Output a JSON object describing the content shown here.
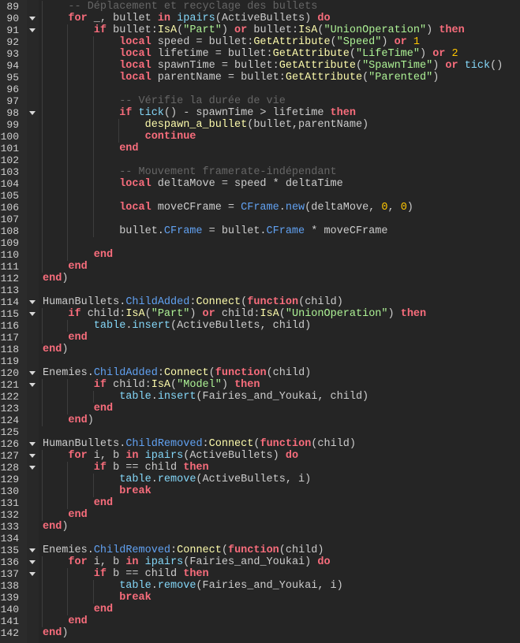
{
  "editor": {
    "colors": {
      "keyword": "#f86d7c",
      "string": "#adf195",
      "number": "#ffc600",
      "method": "#fdfbac",
      "builtin": "#84d6f7",
      "property": "#61a1f1",
      "comment": "#666666",
      "text": "#cccccc",
      "background": "#252525"
    },
    "lines": [
      {
        "num": "89",
        "indent": 4,
        "fold": false,
        "tokens": [
          [
            "cm",
            "-- Déplacement et recyclage des bullets"
          ]
        ]
      },
      {
        "num": "90",
        "indent": 4,
        "fold": true,
        "tokens": [
          [
            "kw",
            "for"
          ],
          [
            "tx",
            " _, bullet "
          ],
          [
            "kw",
            "in"
          ],
          [
            "tx",
            " "
          ],
          [
            "bi",
            "ipairs"
          ],
          [
            "tx",
            "(ActiveBullets) "
          ],
          [
            "kw",
            "do"
          ]
        ]
      },
      {
        "num": "91",
        "indent": 8,
        "fold": true,
        "tokens": [
          [
            "kw",
            "if"
          ],
          [
            "tx",
            " bullet:"
          ],
          [
            "fn",
            "IsA"
          ],
          [
            "tx",
            "("
          ],
          [
            "str",
            "\"Part\""
          ],
          [
            "tx",
            ") "
          ],
          [
            "kw",
            "or"
          ],
          [
            "tx",
            " bullet:"
          ],
          [
            "fn",
            "IsA"
          ],
          [
            "tx",
            "("
          ],
          [
            "str",
            "\"UnionOperation\""
          ],
          [
            "tx",
            ") "
          ],
          [
            "kw",
            "then"
          ]
        ]
      },
      {
        "num": "92",
        "indent": 12,
        "fold": false,
        "tokens": [
          [
            "kw",
            "local"
          ],
          [
            "tx",
            " speed = bullet:"
          ],
          [
            "fn",
            "GetAttribute"
          ],
          [
            "tx",
            "("
          ],
          [
            "str",
            "\"Speed\""
          ],
          [
            "tx",
            ") "
          ],
          [
            "kw",
            "or"
          ],
          [
            "tx",
            " "
          ],
          [
            "num",
            "1"
          ]
        ]
      },
      {
        "num": "93",
        "indent": 12,
        "fold": false,
        "tokens": [
          [
            "kw",
            "local"
          ],
          [
            "tx",
            " lifetime = bullet:"
          ],
          [
            "fn",
            "GetAttribute"
          ],
          [
            "tx",
            "("
          ],
          [
            "str",
            "\"LifeTime\""
          ],
          [
            "tx",
            ") "
          ],
          [
            "kw",
            "or"
          ],
          [
            "tx",
            " "
          ],
          [
            "num",
            "2"
          ]
        ]
      },
      {
        "num": "94",
        "indent": 12,
        "fold": false,
        "tokens": [
          [
            "kw",
            "local"
          ],
          [
            "tx",
            " spawnTime = bullet:"
          ],
          [
            "fn",
            "GetAttribute"
          ],
          [
            "tx",
            "("
          ],
          [
            "str",
            "\"SpawnTime\""
          ],
          [
            "tx",
            ") "
          ],
          [
            "kw",
            "or"
          ],
          [
            "tx",
            " "
          ],
          [
            "bi",
            "tick"
          ],
          [
            "tx",
            "()"
          ]
        ]
      },
      {
        "num": "95",
        "indent": 12,
        "fold": false,
        "tokens": [
          [
            "kw",
            "local"
          ],
          [
            "tx",
            " parentName = bullet:"
          ],
          [
            "fn",
            "GetAttribute"
          ],
          [
            "tx",
            "("
          ],
          [
            "str",
            "\"Parented\""
          ],
          [
            "tx",
            ")"
          ]
        ]
      },
      {
        "num": "96",
        "indent": -1,
        "fold": false,
        "tokens": []
      },
      {
        "num": "97",
        "indent": 12,
        "fold": false,
        "tokens": [
          [
            "cm",
            "-- Vérifie la durée de vie"
          ]
        ]
      },
      {
        "num": "98",
        "indent": 12,
        "fold": true,
        "tokens": [
          [
            "kw",
            "if"
          ],
          [
            "tx",
            " "
          ],
          [
            "bi",
            "tick"
          ],
          [
            "tx",
            "() - spawnTime > lifetime "
          ],
          [
            "kw",
            "then"
          ]
        ]
      },
      {
        "num": "99",
        "indent": 16,
        "fold": false,
        "tokens": [
          [
            "fn",
            "despawn_a_bullet"
          ],
          [
            "tx",
            "(bullet,parentName)"
          ]
        ]
      },
      {
        "num": "100",
        "indent": 16,
        "fold": false,
        "tokens": [
          [
            "kw",
            "continue"
          ]
        ]
      },
      {
        "num": "101",
        "indent": 12,
        "fold": false,
        "tokens": [
          [
            "kw",
            "end"
          ]
        ]
      },
      {
        "num": "102",
        "indent": -1,
        "fold": false,
        "tokens": []
      },
      {
        "num": "103",
        "indent": 12,
        "fold": false,
        "tokens": [
          [
            "cm",
            "-- Mouvement framerate-indépendant"
          ]
        ]
      },
      {
        "num": "104",
        "indent": 12,
        "fold": false,
        "tokens": [
          [
            "kw",
            "local"
          ],
          [
            "tx",
            " deltaMove = speed * deltaTime"
          ]
        ]
      },
      {
        "num": "105",
        "indent": -1,
        "fold": false,
        "tokens": []
      },
      {
        "num": "106",
        "indent": 12,
        "fold": false,
        "tokens": [
          [
            "kw",
            "local"
          ],
          [
            "tx",
            " moveCFrame = "
          ],
          [
            "prop",
            "CFrame"
          ],
          [
            "tx",
            "."
          ],
          [
            "prop",
            "new"
          ],
          [
            "tx",
            "(deltaMove, "
          ],
          [
            "num",
            "0"
          ],
          [
            "tx",
            ", "
          ],
          [
            "num",
            "0"
          ],
          [
            "tx",
            ")"
          ]
        ]
      },
      {
        "num": "107",
        "indent": -1,
        "fold": false,
        "tokens": []
      },
      {
        "num": "108",
        "indent": 12,
        "fold": false,
        "tokens": [
          [
            "tx",
            "bullet."
          ],
          [
            "prop",
            "CFrame"
          ],
          [
            "tx",
            " = bullet."
          ],
          [
            "prop",
            "CFrame"
          ],
          [
            "tx",
            " * moveCFrame"
          ]
        ]
      },
      {
        "num": "109",
        "indent": -1,
        "fold": false,
        "tokens": []
      },
      {
        "num": "110",
        "indent": 8,
        "fold": false,
        "tokens": [
          [
            "kw",
            "end"
          ]
        ]
      },
      {
        "num": "111",
        "indent": 4,
        "fold": false,
        "tokens": [
          [
            "kw",
            "end"
          ]
        ]
      },
      {
        "num": "112",
        "indent": 0,
        "fold": false,
        "tokens": [
          [
            "kw",
            "end"
          ],
          [
            "tx",
            ")"
          ]
        ]
      },
      {
        "num": "113",
        "indent": -1,
        "fold": false,
        "tokens": []
      },
      {
        "num": "114",
        "indent": 0,
        "fold": true,
        "tokens": [
          [
            "tx",
            "HumanBullets."
          ],
          [
            "prop",
            "ChildAdded"
          ],
          [
            "tx",
            ":"
          ],
          [
            "fn",
            "Connect"
          ],
          [
            "tx",
            "("
          ],
          [
            "kw",
            "function"
          ],
          [
            "tx",
            "(child)"
          ]
        ]
      },
      {
        "num": "115",
        "indent": 4,
        "fold": true,
        "tokens": [
          [
            "kw",
            "if"
          ],
          [
            "tx",
            " child:"
          ],
          [
            "fn",
            "IsA"
          ],
          [
            "tx",
            "("
          ],
          [
            "str",
            "\"Part\""
          ],
          [
            "tx",
            ") "
          ],
          [
            "kw",
            "or"
          ],
          [
            "tx",
            " child:"
          ],
          [
            "fn",
            "IsA"
          ],
          [
            "tx",
            "("
          ],
          [
            "str",
            "\"UnionOperation\""
          ],
          [
            "tx",
            ") "
          ],
          [
            "kw",
            "then"
          ]
        ]
      },
      {
        "num": "116",
        "indent": 8,
        "fold": false,
        "tokens": [
          [
            "bi",
            "table"
          ],
          [
            "tx",
            "."
          ],
          [
            "bi",
            "insert"
          ],
          [
            "tx",
            "(ActiveBullets, child)"
          ]
        ]
      },
      {
        "num": "117",
        "indent": 4,
        "fold": false,
        "tokens": [
          [
            "kw",
            "end"
          ]
        ]
      },
      {
        "num": "118",
        "indent": 0,
        "fold": false,
        "tokens": [
          [
            "kw",
            "end"
          ],
          [
            "tx",
            ")"
          ]
        ]
      },
      {
        "num": "119",
        "indent": -1,
        "fold": false,
        "tokens": []
      },
      {
        "num": "120",
        "indent": 0,
        "fold": true,
        "tokens": [
          [
            "tx",
            "Enemies."
          ],
          [
            "prop",
            "ChildAdded"
          ],
          [
            "tx",
            ":"
          ],
          [
            "fn",
            "Connect"
          ],
          [
            "tx",
            "("
          ],
          [
            "kw",
            "function"
          ],
          [
            "tx",
            "(child)"
          ]
        ]
      },
      {
        "num": "121",
        "indent": 8,
        "fold": true,
        "tokens": [
          [
            "kw",
            "if"
          ],
          [
            "tx",
            " child:"
          ],
          [
            "fn",
            "IsA"
          ],
          [
            "tx",
            "("
          ],
          [
            "str",
            "\"Model\""
          ],
          [
            "tx",
            ") "
          ],
          [
            "kw",
            "then"
          ]
        ]
      },
      {
        "num": "122",
        "indent": 12,
        "fold": false,
        "tokens": [
          [
            "bi",
            "table"
          ],
          [
            "tx",
            "."
          ],
          [
            "bi",
            "insert"
          ],
          [
            "tx",
            "(Fairies_and_Youkai, child)"
          ]
        ]
      },
      {
        "num": "123",
        "indent": 8,
        "fold": false,
        "tokens": [
          [
            "kw",
            "end"
          ]
        ]
      },
      {
        "num": "124",
        "indent": 4,
        "fold": false,
        "tokens": [
          [
            "kw",
            "end"
          ],
          [
            "tx",
            ")"
          ]
        ]
      },
      {
        "num": "125",
        "indent": -1,
        "fold": false,
        "tokens": []
      },
      {
        "num": "126",
        "indent": 0,
        "fold": true,
        "tokens": [
          [
            "tx",
            "HumanBullets."
          ],
          [
            "prop",
            "ChildRemoved"
          ],
          [
            "tx",
            ":"
          ],
          [
            "fn",
            "Connect"
          ],
          [
            "tx",
            "("
          ],
          [
            "kw",
            "function"
          ],
          [
            "tx",
            "(child)"
          ]
        ]
      },
      {
        "num": "127",
        "indent": 4,
        "fold": true,
        "tokens": [
          [
            "kw",
            "for"
          ],
          [
            "tx",
            " i, b "
          ],
          [
            "kw",
            "in"
          ],
          [
            "tx",
            " "
          ],
          [
            "bi",
            "ipairs"
          ],
          [
            "tx",
            "(ActiveBullets) "
          ],
          [
            "kw",
            "do"
          ]
        ]
      },
      {
        "num": "128",
        "indent": 8,
        "fold": true,
        "tokens": [
          [
            "kw",
            "if"
          ],
          [
            "tx",
            " b == child "
          ],
          [
            "kw",
            "then"
          ]
        ]
      },
      {
        "num": "129",
        "indent": 12,
        "fold": false,
        "tokens": [
          [
            "bi",
            "table"
          ],
          [
            "tx",
            "."
          ],
          [
            "bi",
            "remove"
          ],
          [
            "tx",
            "(ActiveBullets, i)"
          ]
        ]
      },
      {
        "num": "130",
        "indent": 12,
        "fold": false,
        "tokens": [
          [
            "kw",
            "break"
          ]
        ]
      },
      {
        "num": "131",
        "indent": 8,
        "fold": false,
        "tokens": [
          [
            "kw",
            "end"
          ]
        ]
      },
      {
        "num": "132",
        "indent": 4,
        "fold": false,
        "tokens": [
          [
            "kw",
            "end"
          ]
        ]
      },
      {
        "num": "133",
        "indent": 0,
        "fold": false,
        "tokens": [
          [
            "kw",
            "end"
          ],
          [
            "tx",
            ")"
          ]
        ]
      },
      {
        "num": "134",
        "indent": -1,
        "fold": false,
        "tokens": []
      },
      {
        "num": "135",
        "indent": 0,
        "fold": true,
        "tokens": [
          [
            "tx",
            "Enemies."
          ],
          [
            "prop",
            "ChildRemoved"
          ],
          [
            "tx",
            ":"
          ],
          [
            "fn",
            "Connect"
          ],
          [
            "tx",
            "("
          ],
          [
            "kw",
            "function"
          ],
          [
            "tx",
            "(child)"
          ]
        ]
      },
      {
        "num": "136",
        "indent": 4,
        "fold": true,
        "tokens": [
          [
            "kw",
            "for"
          ],
          [
            "tx",
            " i, b "
          ],
          [
            "kw",
            "in"
          ],
          [
            "tx",
            " "
          ],
          [
            "bi",
            "ipairs"
          ],
          [
            "tx",
            "(Fairies_and_Youkai) "
          ],
          [
            "kw",
            "do"
          ]
        ]
      },
      {
        "num": "137",
        "indent": 8,
        "fold": true,
        "tokens": [
          [
            "kw",
            "if"
          ],
          [
            "tx",
            " b == child "
          ],
          [
            "kw",
            "then"
          ]
        ]
      },
      {
        "num": "138",
        "indent": 12,
        "fold": false,
        "tokens": [
          [
            "bi",
            "table"
          ],
          [
            "tx",
            "."
          ],
          [
            "bi",
            "remove"
          ],
          [
            "tx",
            "(Fairies_and_Youkai, i)"
          ]
        ]
      },
      {
        "num": "139",
        "indent": 12,
        "fold": false,
        "tokens": [
          [
            "kw",
            "break"
          ]
        ]
      },
      {
        "num": "140",
        "indent": 8,
        "fold": false,
        "tokens": [
          [
            "kw",
            "end"
          ]
        ]
      },
      {
        "num": "141",
        "indent": 4,
        "fold": false,
        "tokens": [
          [
            "kw",
            "end"
          ]
        ]
      },
      {
        "num": "142",
        "indent": 0,
        "fold": false,
        "tokens": [
          [
            "kw",
            "end"
          ],
          [
            "tx",
            ")"
          ]
        ]
      }
    ]
  }
}
